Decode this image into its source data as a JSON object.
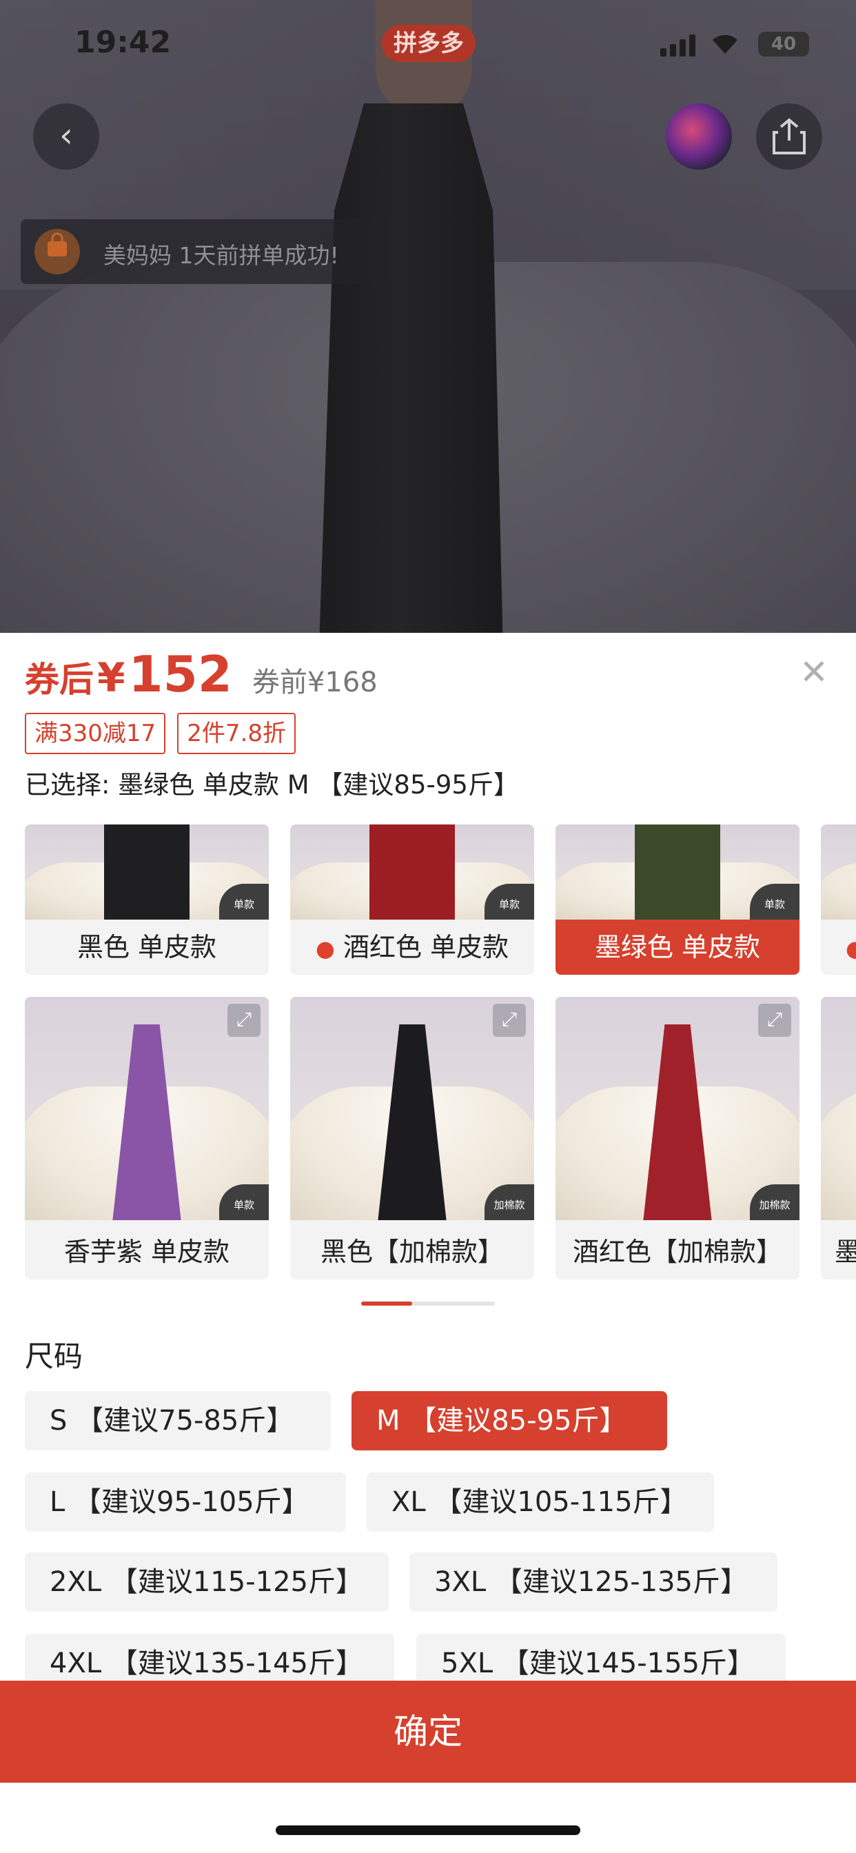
{
  "status_bar": {
    "time": "19:42",
    "app_badge": "拼多多",
    "battery": "40"
  },
  "toast": {
    "message": "美妈妈 1天前拼单成功!"
  },
  "price": {
    "after_label": "券后",
    "currency": "¥",
    "after_value": "152",
    "before": "券前¥168"
  },
  "promo_tags": [
    "满330减17",
    "2件7.8折"
  ],
  "selected_text": "已选择: 墨绿色 单皮款 M 【建议85-95斤】",
  "variants_row1": [
    {
      "label": "黑色 单皮款",
      "badge": "单款",
      "dress_color": "#1f1f22",
      "hot": false,
      "active": false
    },
    {
      "label": "酒红色 单皮款",
      "badge": "单款",
      "dress_color": "#9c1e22",
      "hot": true,
      "active": false
    },
    {
      "label": "墨绿色 单皮款",
      "badge": "单款",
      "dress_color": "#3c4a2a",
      "hot": false,
      "active": true
    }
  ],
  "variants_row2": [
    {
      "label": "香芋紫 单皮款",
      "badge": "单款",
      "dress_color": "#8a55a6"
    },
    {
      "label": "黑色【加棉款】",
      "badge": "加棉款",
      "dress_color": "#1c1c20"
    },
    {
      "label": "酒红色【加棉款】",
      "badge": "加棉款",
      "dress_color": "#a0212a"
    }
  ],
  "partial_next": {
    "row2_label": "墨"
  },
  "size_section": {
    "title": "尺码",
    "options": [
      {
        "label": "S 【建议75-85斤】",
        "active": false
      },
      {
        "label": "M 【建议85-95斤】",
        "active": true
      },
      {
        "label": "L 【建议95-105斤】",
        "active": false
      },
      {
        "label": "XL 【建议105-115斤】",
        "active": false
      },
      {
        "label": "2XL 【建议115-125斤】",
        "active": false
      },
      {
        "label": "3XL 【建议125-135斤】",
        "active": false
      },
      {
        "label": "4XL 【建议135-145斤】",
        "active": false
      },
      {
        "label": "5XL 【建议145-155斤】",
        "active": false
      }
    ]
  },
  "confirm_label": "确定",
  "icons": {
    "back": "‹",
    "share": "⇪",
    "close": "✕",
    "expand": "⤢",
    "fire": "🔥"
  },
  "colors": {
    "accent": "#d6402e"
  }
}
